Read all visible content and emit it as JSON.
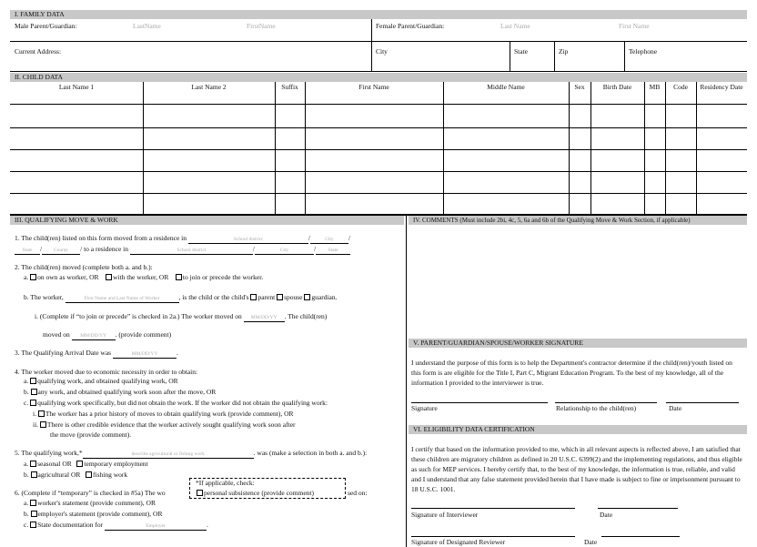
{
  "family": {
    "header": "I. FAMILY DATA",
    "male_label": "Male Parent/Guardian:",
    "male_last": "LastName",
    "male_first": "FirstName",
    "female_label": "Female Parent/Guardian:",
    "female_last": "Last Name",
    "female_first": "First Name",
    "address_label": "Current Address:",
    "city_label": "City",
    "state_label": "State",
    "zip_label": "Zip",
    "telephone_label": "Telephone"
  },
  "child": {
    "header": "II. CHILD DATA",
    "columns": [
      "Last Name 1",
      "Last Name 2",
      "Suffix",
      "First Name",
      "Middle Name",
      "Sex",
      "Birth Date",
      "MB",
      "Code",
      "Residency Date"
    ]
  },
  "qualifying": {
    "header": "III. QUALIFYING MOVE & WORK",
    "q1_a": "1. The child(ren) listed on this form moved from a residence in",
    "q1_b": "to a residence in",
    "ph_school_district": "School district",
    "ph_city": "City",
    "ph_state": "State",
    "ph_county": "County",
    "q2": "2. The child(ren) moved (complete both a. and b.):",
    "q2a_prefix": "a.",
    "q2a_opt1": "on own as worker, OR",
    "q2a_opt2": "with the worker, OR",
    "q2a_opt3": "to join or precede the worker.",
    "q2b_prefix": "b. The worker,",
    "ph_worker_name": "First Name and Last Name of Worker",
    "q2b_mid": ", is the child or the child's",
    "q2b_opt1": "parent",
    "q2b_opt2": "spouse",
    "q2b_opt3": "guardian.",
    "q2i_a": "i. (Complete if “to join or precede” is checked in 2a.) The worker moved on",
    "ph_date": "MM/DD/YY",
    "q2i_b": ". The child(ren)",
    "q2i_c": "moved on",
    "q2i_d": ". (provide comment)",
    "q3": "3. The Qualifying Arrival Date was",
    "q4": "4. The worker moved due to economic necessity in order to obtain:",
    "q4a_prefix": "a.",
    "q4a": "qualifying work, and obtained qualifying work, OR",
    "q4b_prefix": "b.",
    "q4b": "any work, and obtained qualifying work soon after the move, OR",
    "q4c_prefix": "c.",
    "q4c": "qualifying work specifically, but did not obtain the work. If the worker did not obtain the qualifying work:",
    "q4ci_prefix": "i.",
    "q4ci": "The worker has a prior history of moves to obtain qualifying work (provide comment), OR",
    "q4cii_prefix": "ii.",
    "q4cii_a": "There is other credible evidence that the worker actively sought qualifying work soon after",
    "q4cii_b": "the move (provide comment).",
    "q5_a": "5. The qualifying work,*",
    "ph_work": "describe agricultural or fishing work",
    "q5_b": ". was (make a selection in both a. and b.):",
    "q5a_prefix": "a.",
    "q5a_opt1": "seasonal OR",
    "q5a_opt2": "temporary employment",
    "q5b_prefix": "b.",
    "q5b_opt1": "agricultural OR",
    "q5b_opt2": "fishing work",
    "q5_note1": "*If applicable, check:",
    "q5_note2": "personal subsistence (provide comment)",
    "q6_a": "6. (Complete if “temporary” is checked in #5a) The wo",
    "q6_b": "sed on:",
    "q6a_prefix": "a.",
    "q6a": "worker's statement (provide comment), OR",
    "q6b_prefix": "b.",
    "q6b": "employer's statement (provide comment), OR",
    "q6c_prefix": "c.",
    "q6c": "State documentation for",
    "ph_employer": "Employer",
    "q6c_end": "."
  },
  "comments": {
    "header": "IV. COMMENTS (Must include 2bi, 4c, 5, 6a and 6b of the Qualifying Move & Work Section, if applicable)"
  },
  "signature": {
    "header": "V. PARENT/GUARDIAN/SPOUSE/WORKER SIGNATURE",
    "text": "I understand the purpose of this form is to help the Department's contractor determine if the child(ren)/youth listed on this form is are eligible for the Title I, Part C, Migrant Education Program. To the best of my knowledge, all of the information I provided to the interviewer is true.",
    "sig_label": "Signature",
    "rel_label": "Relationship to the child(ren)",
    "date_label": "Date"
  },
  "certification": {
    "header": "VI. ELIGIBILITY DATA CERTIFICATION",
    "text": "I certify that based on the information provided to me, which in all relevant aspects is reflected above, I am satisfied that these children are migratory children as defined in 20 U.S.C. 6399(2) and the implementing regulations, and thus eligible as such for MEP services.  I hereby certify that, to the best of my knowledge, the information is true, reliable, and valid and I understand that any false statement provided herein that I have made is subject to fine or imprisonment pursuant to 18 U.S.C. 1001.",
    "interviewer_label": "Signature of Interviewer",
    "date1_label": "Date",
    "reviewer_label": "Signature of Designated Reviewer",
    "date2_label": "Date"
  }
}
